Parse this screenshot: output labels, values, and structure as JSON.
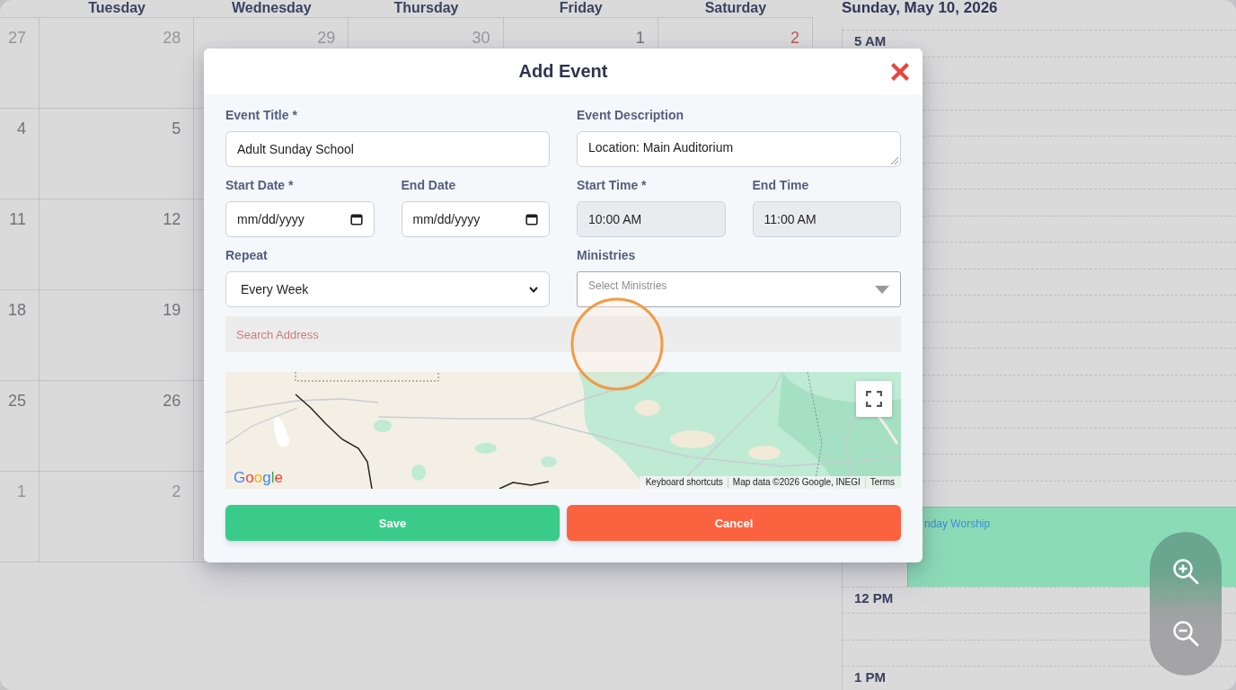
{
  "month_view": {
    "weekdays": [
      "Tuesday",
      "Wednesday",
      "Thursday",
      "Friday",
      "Saturday"
    ],
    "weeks": [
      [
        {
          "day": "27",
          "other_month": true,
          "highlighted": false
        },
        {
          "day": "28",
          "other_month": true,
          "highlighted": false
        },
        {
          "day": "29",
          "other_month": true,
          "highlighted": false
        },
        {
          "day": "30",
          "other_month": true,
          "highlighted": false
        },
        {
          "day": "1",
          "other_month": false,
          "highlighted": false
        },
        {
          "day": "2",
          "other_month": false,
          "highlighted": true
        }
      ],
      [
        {
          "day": "4",
          "other_month": false,
          "highlighted": false
        },
        {
          "day": "5",
          "other_month": false,
          "highlighted": false
        }
      ],
      [
        {
          "day": "11",
          "other_month": false,
          "highlighted": false
        },
        {
          "day": "12",
          "other_month": false,
          "highlighted": false
        }
      ],
      [
        {
          "day": "18",
          "other_month": false,
          "highlighted": false
        },
        {
          "day": "19",
          "other_month": false,
          "highlighted": false
        }
      ],
      [
        {
          "day": "25",
          "other_month": false,
          "highlighted": false
        },
        {
          "day": "26",
          "other_month": false,
          "highlighted": false
        }
      ],
      [
        {
          "day": "1",
          "other_month": true,
          "highlighted": false
        },
        {
          "day": "2",
          "other_month": true,
          "highlighted": false
        }
      ]
    ]
  },
  "day_view": {
    "title": "Sunday, May 10, 2026",
    "hours": [
      "5 AM",
      "12 PM",
      "1 PM"
    ],
    "events": [
      {
        "title": "nday Worship"
      }
    ]
  },
  "modal": {
    "title": "Add Event",
    "rows": [
      [
        {
          "kind": "text",
          "label": "Event Title *",
          "value": "Adult Sunday School",
          "disabled": false
        },
        {
          "kind": "textarea",
          "label": "Event Description",
          "value": "Location: Main Auditorium",
          "disabled": false
        }
      ],
      [
        {
          "kind": "date",
          "label": "Start Date *",
          "placeholder": "mm/dd/yyyy",
          "disabled": false
        },
        {
          "kind": "date",
          "label": "End Date",
          "placeholder": "mm/dd/yyyy",
          "disabled": false
        },
        {
          "kind": "time",
          "label": "Start Time *",
          "value": "10:00 AM",
          "disabled": true
        },
        {
          "kind": "time",
          "label": "End Time",
          "value": "11:00 AM",
          "disabled": true
        }
      ],
      [
        {
          "kind": "select",
          "label": "Repeat",
          "value": "Every Week",
          "disabled": false
        },
        {
          "kind": "multiselect",
          "label": "Ministries",
          "placeholder": "Select Ministries",
          "disabled": false
        }
      ],
      [
        {
          "kind": "search",
          "placeholder": "Search Address",
          "disabled": false
        }
      ]
    ],
    "map": {
      "logo": "Google",
      "shortcuts_link": "Keyboard shortcuts",
      "map_data": "Map data ©2026 Google, INEGI",
      "terms_link": "Terms"
    },
    "buttons": [
      {
        "kind": "save",
        "label": "Save"
      },
      {
        "kind": "cancel",
        "label": "Cancel"
      }
    ]
  }
}
